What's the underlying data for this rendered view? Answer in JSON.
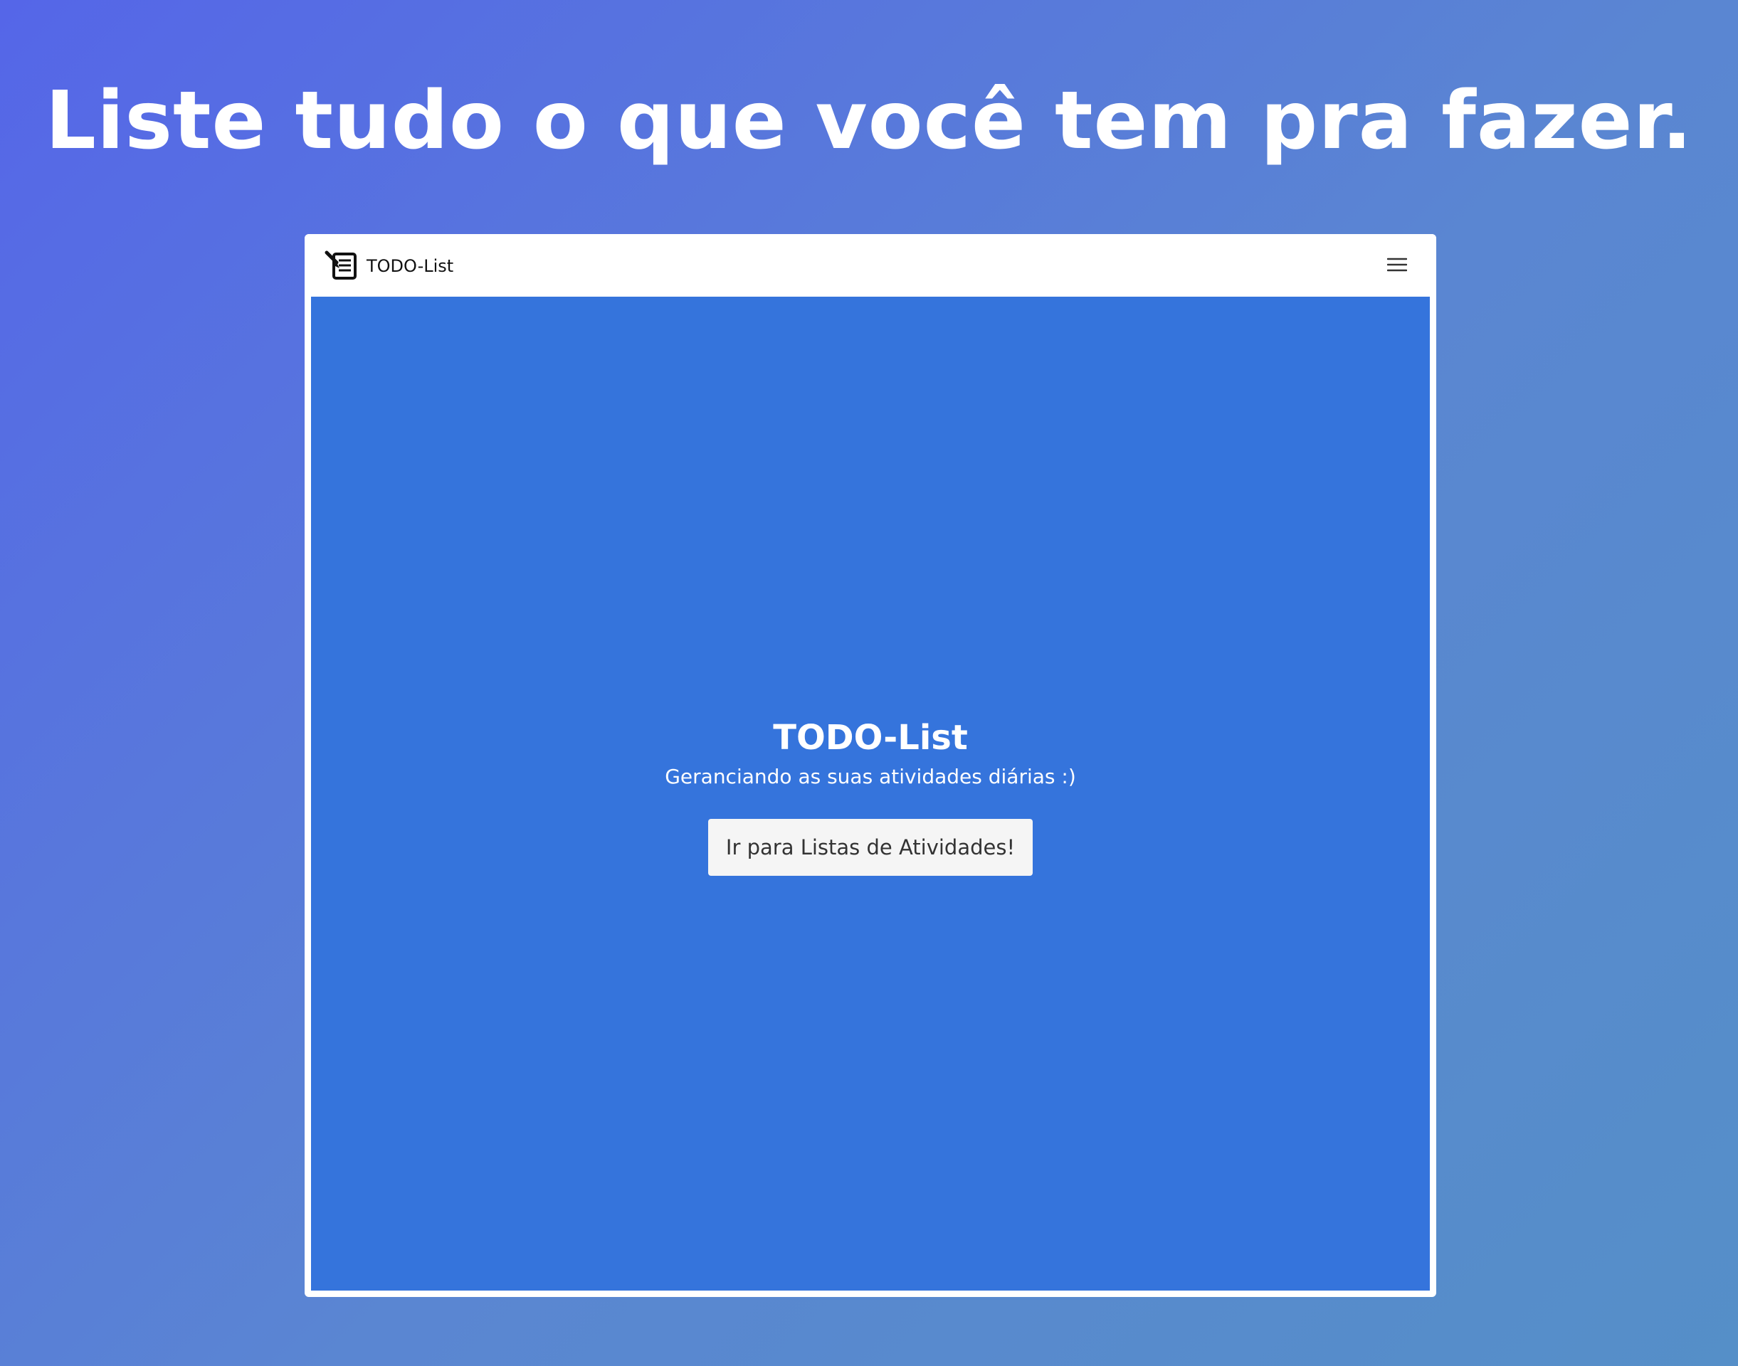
{
  "headline": "Liste tudo o que você tem pra fazer.",
  "navbar": {
    "brand_label": "TODO-List",
    "brand_icon": "notepad-pencil-icon",
    "menu_icon": "hamburger-menu-icon"
  },
  "hero": {
    "title": "TODO-List",
    "subtitle": "Geranciando as suas atividades diárias :)",
    "button_label": "Ir para Listas de Atividades!"
  },
  "colors": {
    "background_gradient_start": "#5566e8",
    "background_gradient_end": "#558fc8",
    "hero_background": "#3574dc",
    "navbar_background": "#ffffff",
    "button_background": "#f5f5f5",
    "button_text": "#333333"
  }
}
